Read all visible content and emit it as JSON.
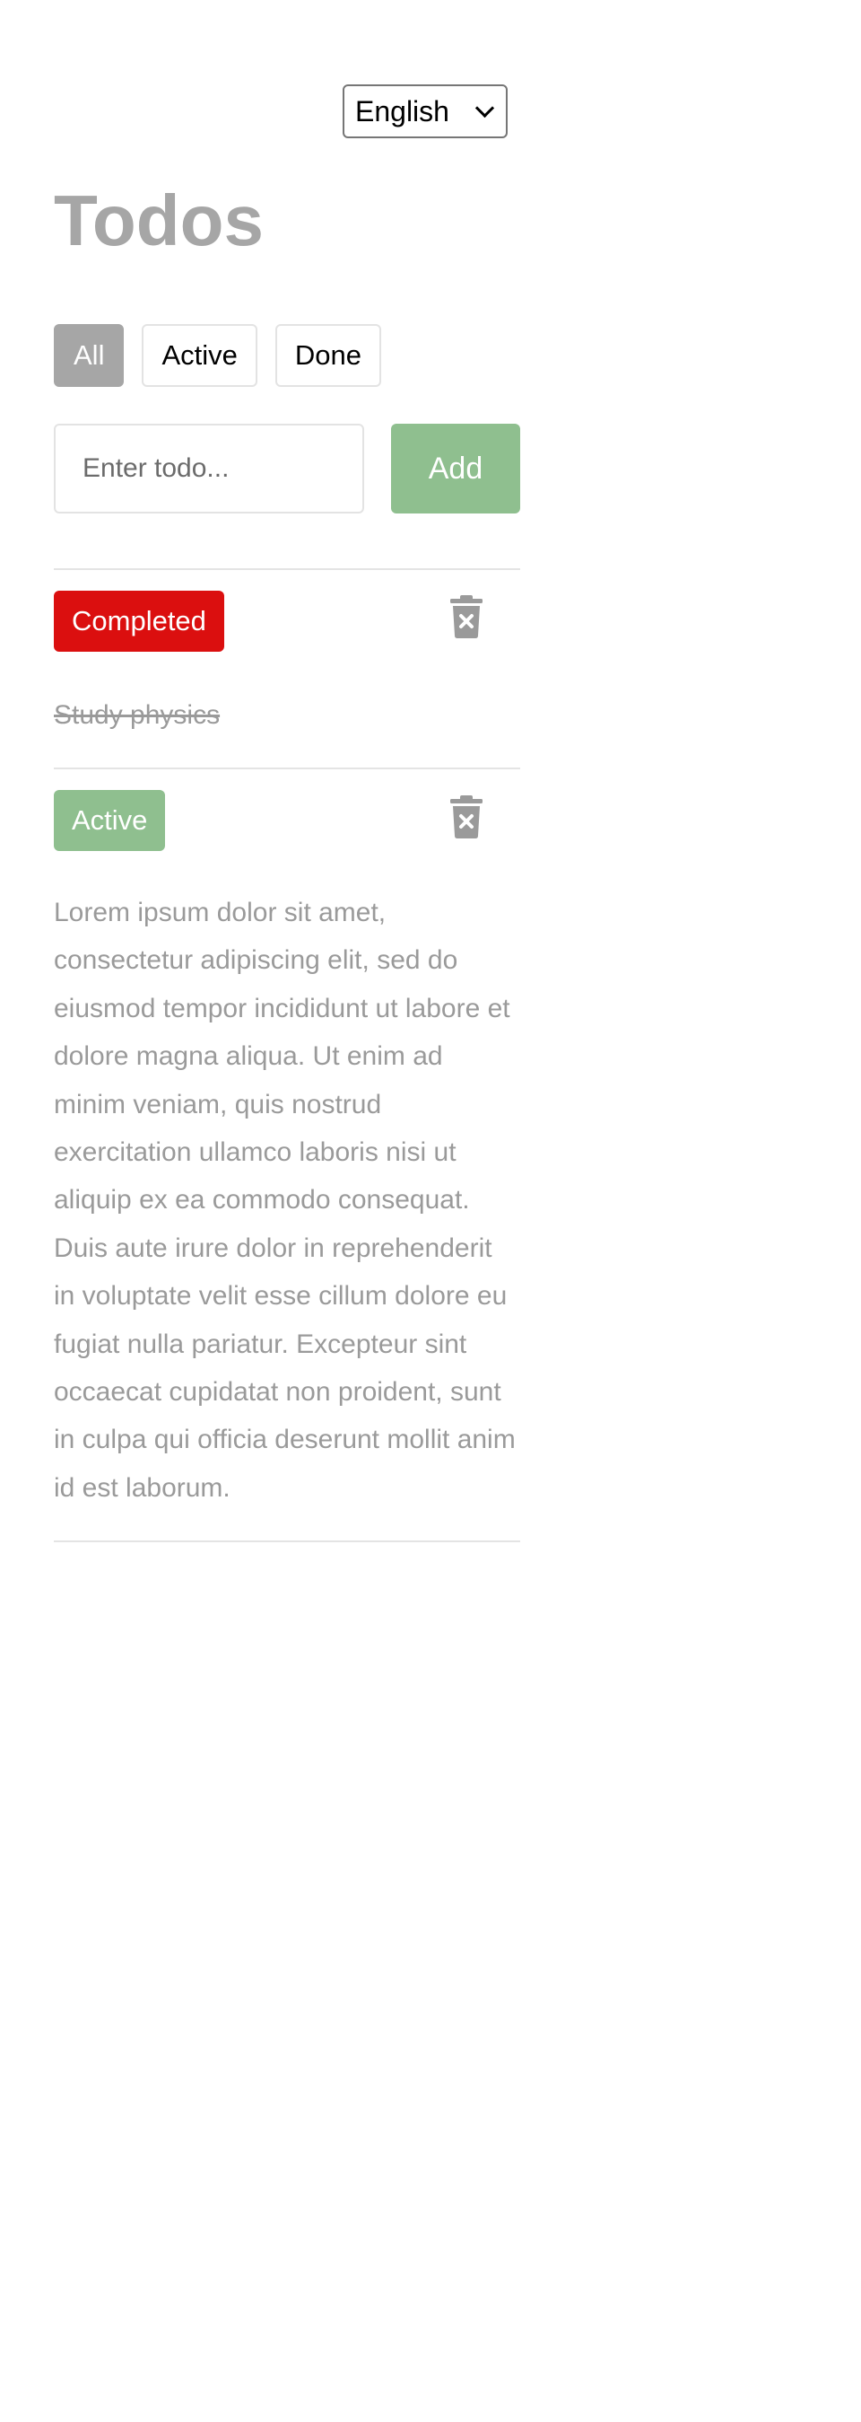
{
  "language": {
    "selected": "English"
  },
  "page": {
    "title": "Todos"
  },
  "filters": [
    {
      "label": "All",
      "active": true
    },
    {
      "label": "Active",
      "active": false
    },
    {
      "label": "Done",
      "active": false
    }
  ],
  "add_form": {
    "placeholder": "Enter todo...",
    "value": "",
    "button_label": "Add"
  },
  "todos": [
    {
      "status_label": "Completed",
      "status_color": "#db0f0f",
      "text": "Study physics",
      "icon": "trash-icon"
    },
    {
      "status_label": "Active",
      "status_color": "#8fbf8f",
      "text": "Lorem ipsum dolor sit amet, consectetur adipiscing elit, sed do eiusmod tempor incididunt ut labore et dolore magna aliqua. Ut enim ad minim veniam, quis nostrud exercitation ullamco laboris nisi ut aliquip ex ea commodo consequat. Duis aute irure dolor in reprehenderit in voluptate velit esse cillum dolore eu fugiat nulla pariatur. Excepteur sint occaecat cupidatat non proident, sunt in culpa qui officia deserunt mollit anim id est laborum.",
      "icon": "trash-icon"
    }
  ],
  "colors": {
    "accent_green": "#8fbf8f",
    "completed_red": "#db0f0f",
    "muted_gray": "#a6a6a6"
  }
}
